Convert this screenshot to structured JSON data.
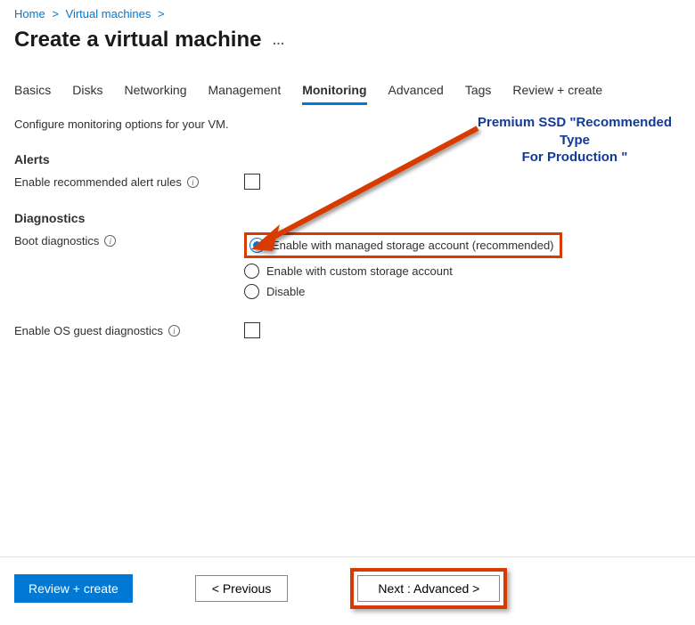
{
  "breadcrumb": {
    "home": "Home",
    "vms": "Virtual machines"
  },
  "title": "Create a virtual machine",
  "tabs": {
    "basics": "Basics",
    "disks": "Disks",
    "networking": "Networking",
    "management": "Management",
    "monitoring": "Monitoring",
    "advanced": "Advanced",
    "tags": "Tags",
    "review": "Review + create"
  },
  "desc": "Configure monitoring options for your VM.",
  "sections": {
    "alerts": "Alerts",
    "diagnostics": "Diagnostics"
  },
  "labels": {
    "alerts_enable": "Enable recommended alert rules",
    "boot_diag": "Boot diagnostics",
    "os_guest": "Enable OS guest diagnostics"
  },
  "radios": {
    "opt1": "Enable with managed storage account (recommended)",
    "opt2": "Enable with custom storage account",
    "opt3": "Disable"
  },
  "footer": {
    "review": "Review + create",
    "prev": "<  Previous",
    "next": "Next : Advanced  >"
  },
  "annotation": {
    "line1": "Premium SSD \"Recommended Type",
    "line2": "For Production \""
  }
}
